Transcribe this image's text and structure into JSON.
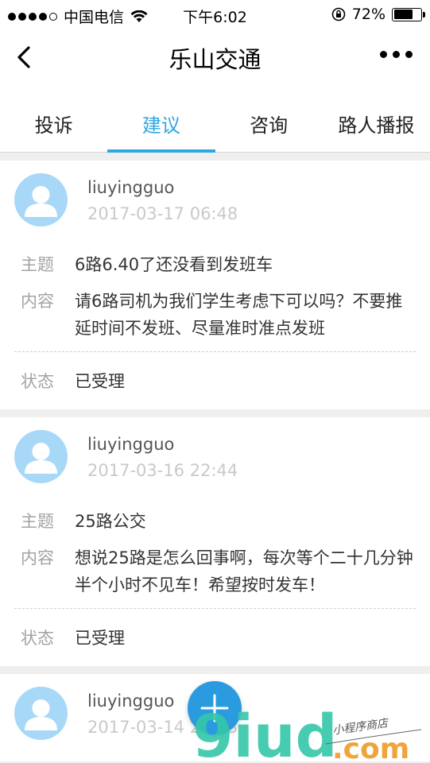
{
  "statusbar": {
    "carrier": "中国电信",
    "time": "下午6:02",
    "battery": "72%",
    "battery_level": 0.72
  },
  "navbar": {
    "title": "乐山交通"
  },
  "tabs": [
    {
      "label": "投诉"
    },
    {
      "label": "建议"
    },
    {
      "label": "咨询"
    },
    {
      "label": "路人播报"
    }
  ],
  "active_tab": "建议",
  "labels": {
    "subject": "主题",
    "content": "内容",
    "status": "状态"
  },
  "posts": [
    {
      "user": "liuyingguo",
      "date": "2017-03-17 06:48",
      "subject": "6路6.40了还没看到发班车",
      "content": "请6路司机为我们学生考虑下可以吗？不要推延时间不发班、尽量准时准点发班",
      "status": "已受理"
    },
    {
      "user": "liuyingguo",
      "date": "2017-03-16 22:44",
      "subject": "25路公交",
      "content": "想说25路是怎么回事啊，每次等个二十几分钟半个小时不见车！希望按时发车！",
      "status": "已受理"
    },
    {
      "user": "liuyingguo",
      "date": "2017-03-14 23:23"
    }
  ],
  "watermark": {
    "brand": "9iud",
    "domain": ".com",
    "tagline": "小程序商店"
  },
  "colors": {
    "accent": "#2fa7e3",
    "avatar": "#a8d8f8",
    "fab": "#2b9be0"
  }
}
